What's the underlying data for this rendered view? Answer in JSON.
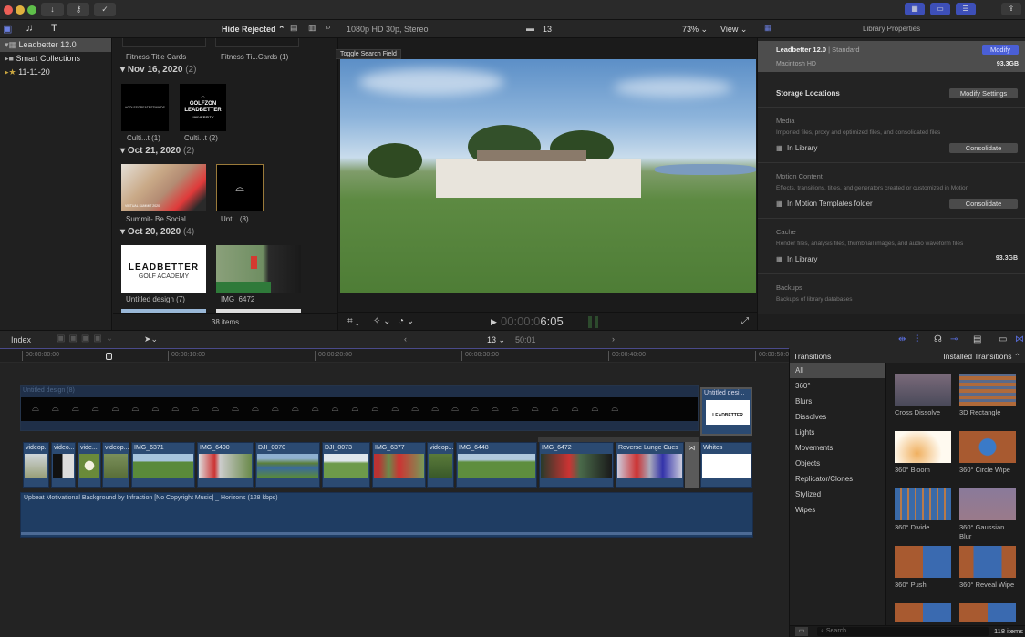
{
  "titlebar": {
    "import_icon": "arrow-down-icon",
    "keywords_icon": "key-icon",
    "background_tasks_icon": "checkmark-circle-icon",
    "right_icons": [
      "browser-layout-icon",
      "timeline-layout-icon",
      "inspector-layout-icon",
      "share-icon"
    ]
  },
  "libraries": {
    "items": [
      {
        "label": "Leadbetter 12.0",
        "selected": true
      },
      {
        "label": "Smart Collections"
      },
      {
        "label": "11-11-20"
      }
    ]
  },
  "browser": {
    "filter": "Hide Rejected",
    "tooltip": "Toggle Search Field",
    "top_captions": [
      "Fitness Title Cards",
      "Fitness Ti...Cards  (1)"
    ],
    "groups": [
      {
        "date": "Nov 16, 2020",
        "count": "(2)",
        "items": [
          "Culti...t (1)",
          "Culti...t (2)"
        ]
      },
      {
        "date": "Oct 21, 2020",
        "count": "(2)",
        "items": [
          "Summit- Be Social",
          "Unti...(8)"
        ]
      },
      {
        "date": "Oct 20, 2020",
        "count": "(4)",
        "items": [
          "Untitled design (7)",
          "IMG_6472"
        ]
      }
    ],
    "thumb_text": {
      "hashtag": "#GOLFSGREATESTMINDS",
      "golfzon": "GOLFZON",
      "leadbetter": "LEADBETTER",
      "university": "UNIVERSITY",
      "academy1": "LEADBETTER",
      "academy2": "GOLF ACADEMY",
      "summit": "VIRTUAL SUMMIT 2020"
    },
    "item_count": "38 items"
  },
  "viewer": {
    "format": "1080p HD 30p, Stereo",
    "clip_count": "13",
    "zoom": "73%",
    "view": "View",
    "timecode_dim": "00:00:0",
    "timecode": "6:05"
  },
  "inspector": {
    "title": "Library Properties",
    "library": "Leadbetter 12.0",
    "library_type": "| Standard",
    "modify": "Modify",
    "disk": "Macintosh HD",
    "disk_size": "93.3GB",
    "storage_title": "Storage Locations",
    "modify_settings": "Modify Settings",
    "sections": [
      {
        "title": "Media",
        "desc": "Imported files, proxy and optimized files, and consolidated files",
        "location": "In Library",
        "button": "Consolidate"
      },
      {
        "title": "Motion Content",
        "desc": "Effects, transitions, titles, and generators created or customized in Motion",
        "location": "In Motion Templates folder",
        "button": "Consolidate"
      },
      {
        "title": "Cache",
        "desc": "Render files, analysis files, thumbnail images, and audio waveform files",
        "location": "In Library",
        "size": "93.3GB"
      },
      {
        "title": "Backups",
        "desc": "Backups of library databases"
      }
    ]
  },
  "timeline": {
    "index": "Index",
    "project_count": "13",
    "duration": "50:01",
    "ruler": [
      "00:00:00:00",
      "00:00:10:00",
      "00:00:20:00",
      "00:00:30:00",
      "00:00:40:00",
      "00:00:50:0"
    ],
    "title_clip": "Untitled design (8)",
    "title_clip2": "Untitled desi...",
    "clips": [
      "videop...",
      "video...",
      "vide...",
      "videop...",
      "IMG_6371",
      "IMG_6400",
      "DJI_0070",
      "DJI_0073",
      "IMG_6377",
      "videop...",
      "IMG_6448",
      "IMG_6472",
      "Reverse Lunge Cues",
      "",
      "Whites"
    ],
    "audio_clip": "Upbeat Motivational Background by Infraction [No Copyright Music] _ Horizons (128 kbps)"
  },
  "transitions": {
    "title": "Transitions",
    "source": "Installed Transitions",
    "categories": [
      "All",
      "360°",
      "Blurs",
      "Dissolves",
      "Lights",
      "Movements",
      "Objects",
      "Replicator/Clones",
      "Stylized",
      "Wipes"
    ],
    "items": [
      "Cross Dissolve",
      "3D Rectangle",
      "360° Bloom",
      "360° Circle Wipe",
      "360° Divide",
      "360° Gaussian Blur",
      "360° Push",
      "360° Reveal Wipe",
      "",
      ""
    ],
    "search_placeholder": "Search",
    "count": "118 items"
  },
  "colors": {
    "accent": "#4a5fd6",
    "clip": "#2b4a72",
    "selected": "#4a4a4a"
  }
}
